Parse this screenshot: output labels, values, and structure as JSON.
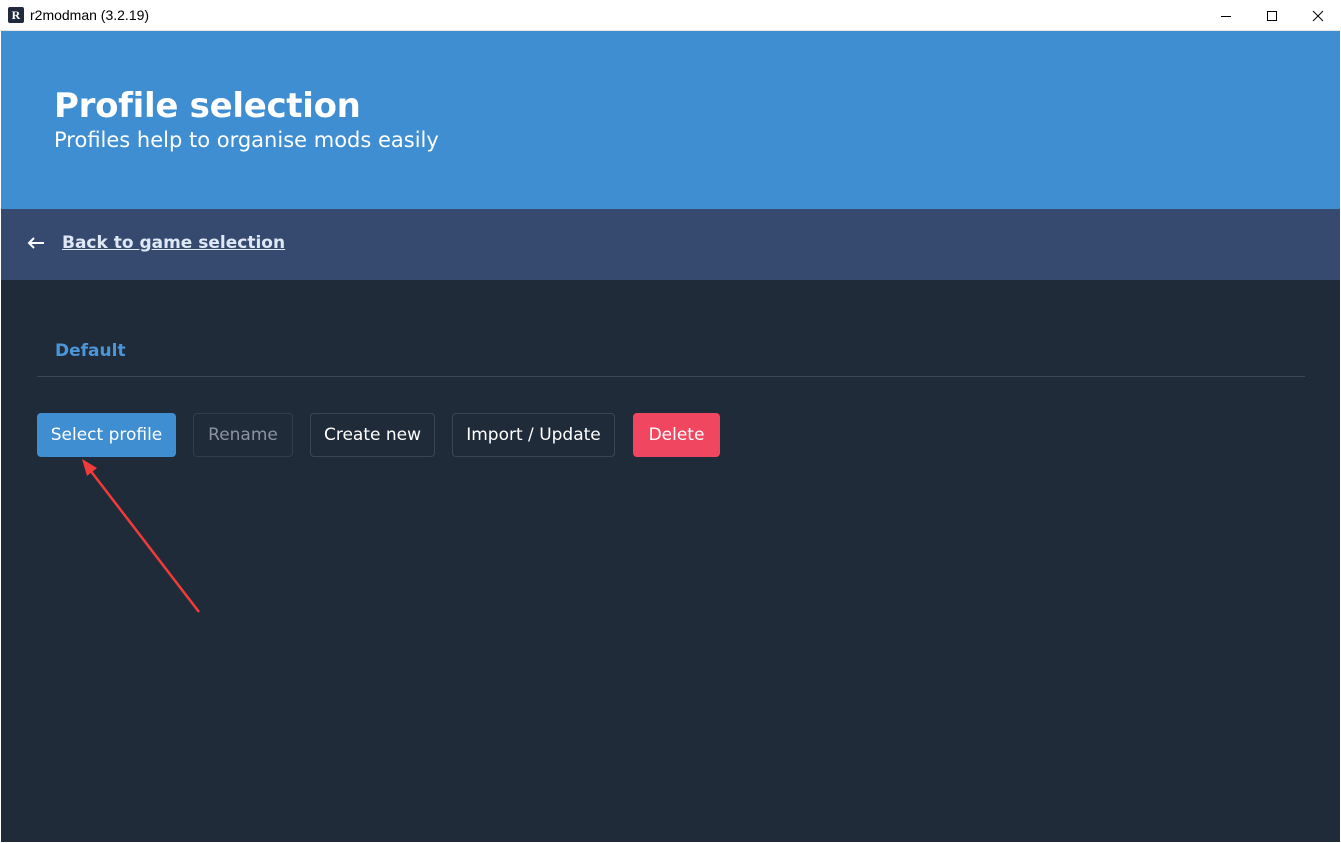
{
  "window": {
    "title": "r2modman (3.2.19)",
    "app_icon_letter": "R"
  },
  "hero": {
    "title": "Profile selection",
    "subtitle": "Profiles help to organise mods easily"
  },
  "nav": {
    "back_label": "Back to game selection"
  },
  "profiles": [
    {
      "name": "Default"
    }
  ],
  "actions": {
    "select_label": "Select profile",
    "rename_label": "Rename",
    "create_label": "Create new",
    "import_label": "Import / Update",
    "delete_label": "Delete"
  },
  "colors": {
    "accent": "#3f8ed2",
    "nav_bar": "#364a70",
    "background": "#202b3a",
    "danger": "#f0465f",
    "annotation_arrow": "#f03b3b"
  }
}
